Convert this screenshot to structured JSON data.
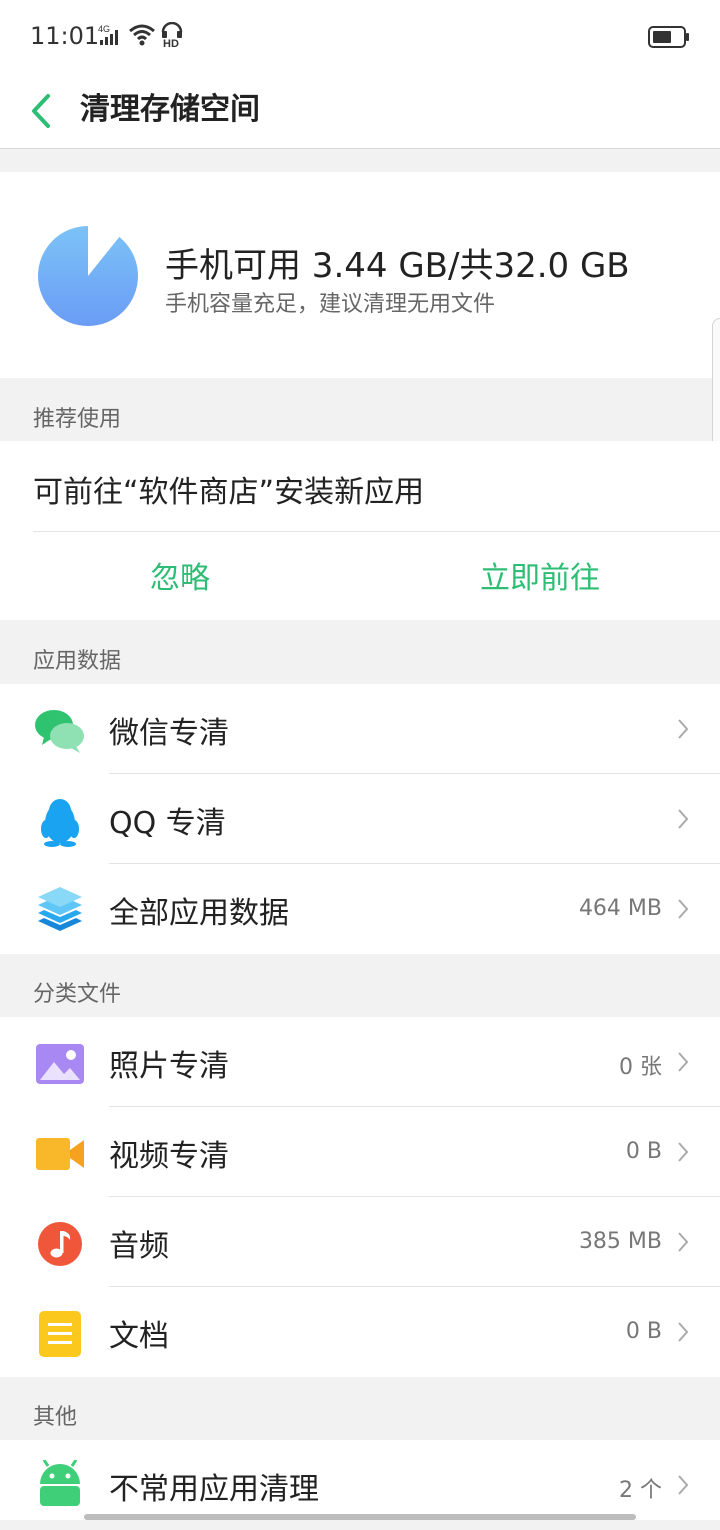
{
  "status_bar": {
    "time": "11:01",
    "network": "4G",
    "icons": [
      "signal-icon",
      "wifi-icon",
      "hd-icon",
      "battery-icon"
    ]
  },
  "nav": {
    "title": "清理存储空间",
    "back_icon": "chevron-left-icon"
  },
  "storage": {
    "main_text": "手机可用 3.44 GB/共32.0 GB",
    "sub_text": "手机容量充足，建议清理无用文件",
    "available_gb": 3.44,
    "total_gb": 32.0
  },
  "recommend": {
    "header": "推荐使用",
    "text": "可前往“软件商店”安装新应用",
    "ignore_label": "忽略",
    "go_label": "立即前往"
  },
  "app_data": {
    "header": "应用数据",
    "items": [
      {
        "label": "微信专清",
        "value": "",
        "icon": "wechat-icon"
      },
      {
        "label": "QQ 专清",
        "value": "",
        "icon": "qq-penguin-icon"
      },
      {
        "label": "全部应用数据",
        "value": "464 MB",
        "icon": "layers-icon"
      }
    ]
  },
  "files": {
    "header": "分类文件",
    "items": [
      {
        "label": "照片专清",
        "value": "0 张",
        "icon": "photo-icon"
      },
      {
        "label": "视频专清",
        "value": "0 B",
        "icon": "video-camera-icon"
      },
      {
        "label": "音频",
        "value": "385 MB",
        "icon": "music-note-icon"
      },
      {
        "label": "文档",
        "value": "0 B",
        "icon": "document-icon"
      }
    ]
  },
  "other": {
    "header": "其他",
    "items": [
      {
        "label": "不常用应用清理",
        "value": "2 个",
        "icon": "android-icon"
      }
    ]
  },
  "colors": {
    "accent": "#2dbd74",
    "pie_fill": "#6aa6f5",
    "background": "#f2f2f2"
  }
}
